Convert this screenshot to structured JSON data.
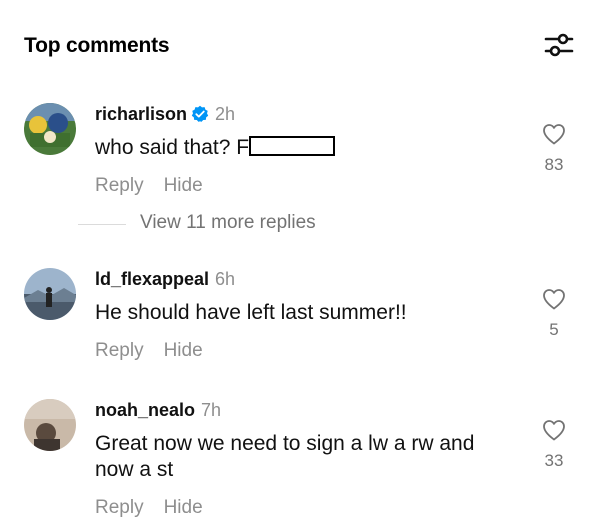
{
  "header": {
    "title": "Top comments",
    "filter_icon": "sliders-icon"
  },
  "comments": [
    {
      "username": "richarlison",
      "verified": true,
      "time": "2h",
      "text": "who said that? F",
      "redacted": true,
      "reply_label": "Reply",
      "hide_label": "Hide",
      "likes": "83"
    },
    {
      "username": "ld_flexappeal",
      "verified": false,
      "time": "6h",
      "text": "He should have left last summer!!",
      "reply_label": "Reply",
      "hide_label": "Hide",
      "likes": "5"
    },
    {
      "username": "noah_nealo",
      "verified": false,
      "time": "7h",
      "text": "Great now we need to sign a lw a rw and now a st",
      "reply_label": "Reply",
      "hide_label": "Hide",
      "likes": "33"
    }
  ],
  "view_more_replies": "View 11 more replies",
  "colors": {
    "verified_badge": "#0095f6",
    "secondary_text": "#8e8e8e"
  }
}
